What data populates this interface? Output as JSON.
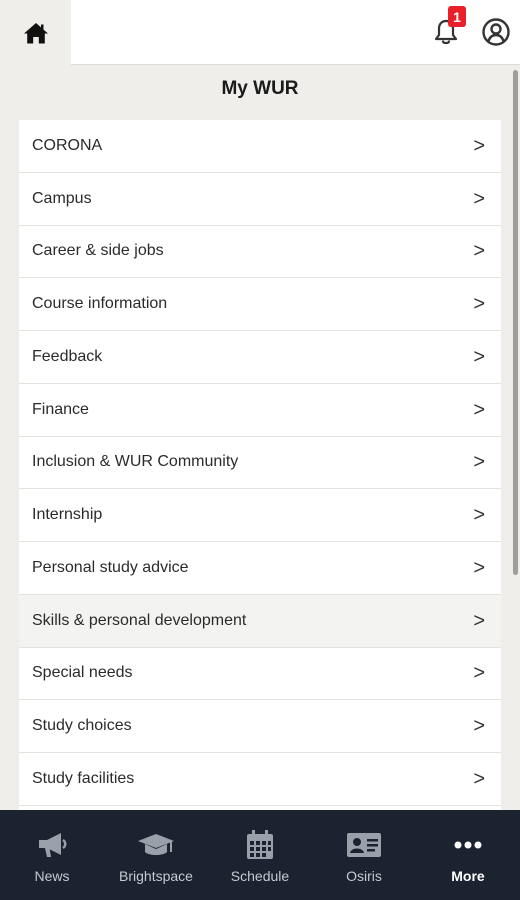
{
  "header": {
    "home_icon": "home-icon",
    "notification_icon": "bell-icon",
    "notification_count": "1",
    "account_icon": "account-icon",
    "badge_color": "#e8202a"
  },
  "page": {
    "title": "My WUR"
  },
  "menu": {
    "items": [
      {
        "label": "CORONA"
      },
      {
        "label": "Campus"
      },
      {
        "label": "Career & side jobs"
      },
      {
        "label": "Course information"
      },
      {
        "label": "Feedback"
      },
      {
        "label": "Finance"
      },
      {
        "label": "Inclusion & WUR Community"
      },
      {
        "label": "Internship"
      },
      {
        "label": "Personal study advice"
      },
      {
        "label": "Skills & personal development"
      },
      {
        "label": "Special needs"
      },
      {
        "label": "Study choices"
      },
      {
        "label": "Study facilities"
      }
    ],
    "chevron": ">"
  },
  "bottom_nav": {
    "background": "#1b2330",
    "items": [
      {
        "label": "News",
        "icon": "megaphone-icon"
      },
      {
        "label": "Brightspace",
        "icon": "graduation-cap-icon"
      },
      {
        "label": "Schedule",
        "icon": "calendar-icon"
      },
      {
        "label": "Osiris",
        "icon": "id-card-icon"
      },
      {
        "label": "More",
        "icon": "more-dots-icon"
      }
    ]
  }
}
